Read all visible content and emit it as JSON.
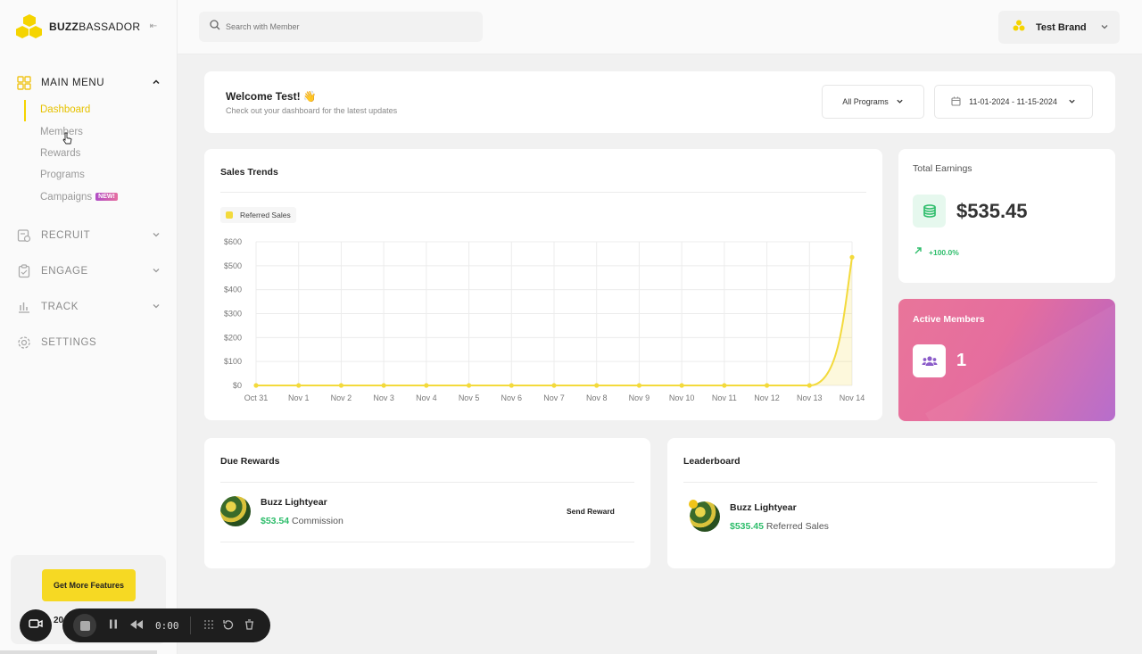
{
  "brand": {
    "name_bold": "BUZZ",
    "name_rest": "BASSADOR"
  },
  "sidebar": {
    "main_menu": "MAIN MENU",
    "items": [
      {
        "label": "Dashboard"
      },
      {
        "label": "Members"
      },
      {
        "label": "Rewards"
      },
      {
        "label": "Programs"
      },
      {
        "label": "Campaigns",
        "badge": "NEW!"
      }
    ],
    "sections": [
      {
        "label": "RECRUIT"
      },
      {
        "label": "ENGAGE"
      },
      {
        "label": "TRACK"
      },
      {
        "label": "SETTINGS"
      }
    ],
    "promo_button": "Get More Features",
    "peek_text": "20"
  },
  "recorder": {
    "time": "0:00"
  },
  "search": {
    "placeholder": "Search with Member"
  },
  "account": {
    "brand_label": "Test Brand"
  },
  "welcome": {
    "title": "Welcome Test! 👋",
    "subtitle": "Check out your dashboard for the latest updates",
    "programs_filter": "All Programs",
    "date_range": "11-01-2024 - 11-15-2024"
  },
  "sales": {
    "title": "Sales Trends",
    "legend": "Referred Sales"
  },
  "earnings": {
    "title": "Total Earnings",
    "amount": "$535.45",
    "change": "+100.0%"
  },
  "members": {
    "title": "Active Members",
    "count": "1"
  },
  "due_rewards": {
    "title": "Due Rewards",
    "name": "Buzz Lightyear",
    "value": "$53.54",
    "label": "Commission",
    "action": "Send Reward"
  },
  "leaderboard": {
    "title": "Leaderboard",
    "name": "Buzz Lightyear",
    "value": "$535.45",
    "label": "Referred Sales"
  },
  "colors": {
    "accent": "#f5d400",
    "positive": "#2ebd6b",
    "series": "#f3da3c"
  },
  "chart_data": {
    "type": "area",
    "x": [
      "Oct 31",
      "Nov 1",
      "Nov 2",
      "Nov 3",
      "Nov 4",
      "Nov 5",
      "Nov 6",
      "Nov 7",
      "Nov 8",
      "Nov 9",
      "Nov 10",
      "Nov 11",
      "Nov 12",
      "Nov 13",
      "Nov 14"
    ],
    "series": [
      {
        "name": "Referred Sales",
        "values": [
          0,
          0,
          0,
          0,
          0,
          0,
          0,
          0,
          0,
          0,
          0,
          0,
          0,
          0,
          535.45
        ]
      }
    ],
    "yticks": [
      "$0",
      "$100",
      "$200",
      "$300",
      "$400",
      "$500",
      "$600"
    ],
    "ylim": [
      0,
      600
    ],
    "grid": true,
    "legend": "top-left"
  }
}
